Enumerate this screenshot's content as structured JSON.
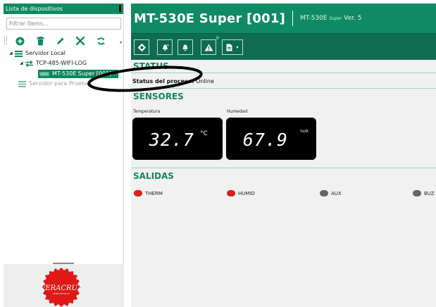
{
  "left_panel": {
    "title": "Lista de dispositivos",
    "filter_placeholder": "Filtrar ítems...",
    "toolbar_icons": [
      "add-icon",
      "delete-icon",
      "edit-icon",
      "tools-icon",
      "refresh-icon"
    ],
    "tree": {
      "server_local": "Servidor Local",
      "tcp": "TCP-485-WIFI-LOG",
      "device": "MT-530E Super [001]",
      "server_test": "Servidor para Pruebas"
    },
    "logo_text": "VERACRUZ",
    "logo_subtext": "TIENDA VIRTUAL DE"
  },
  "header": {
    "title": "MT-530E Super [001]",
    "model": "MT-530E",
    "model_sub": "Super",
    "version": "Ver. 5"
  },
  "toolbar": {
    "buttons": [
      "gear-icon",
      "alarm-icon",
      "bell-icon",
      "warning-icon",
      "document-icon"
    ],
    "warning_count": "0"
  },
  "status": {
    "heading": "STATUS",
    "label": "Status del proceso:",
    "value": "Online"
  },
  "sensors": {
    "heading": "SENSORES",
    "temperature": {
      "label": "Temperatura",
      "value": "32.7",
      "unit": "°C"
    },
    "humidity": {
      "label": "Humedad",
      "value": "67.9",
      "unit": "%UR"
    }
  },
  "outputs": {
    "heading": "SALIDAS",
    "items": [
      {
        "name": "THERM",
        "state": "on",
        "color": "#e21b1b"
      },
      {
        "name": "HUMID",
        "state": "on",
        "color": "#e21b1b"
      },
      {
        "name": "AUX",
        "state": "off",
        "color": "#666666"
      },
      {
        "name": "BUZ",
        "state": "off",
        "color": "#666666"
      }
    ]
  },
  "colors": {
    "brand": "#0f8a63",
    "toolbar": "#0f6c50",
    "heading": "#148760"
  }
}
